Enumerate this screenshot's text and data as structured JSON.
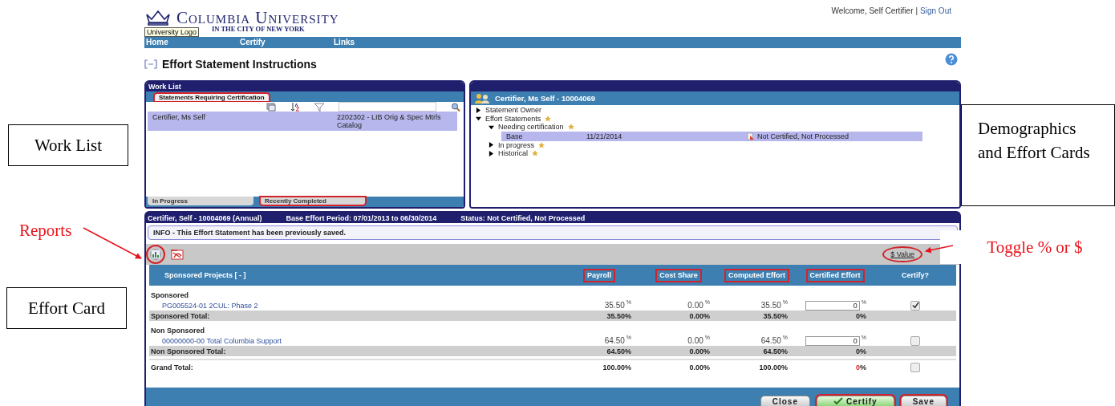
{
  "header": {
    "logo_name": "Columbia University",
    "logo_subtitle": "IN THE CITY OF NEW YORK",
    "tooltip": "University Logo",
    "welcome": "Welcome, Self Certifier",
    "separator": "|",
    "sign_out": "Sign Out"
  },
  "nav": [
    "Home",
    "Certify",
    "Links"
  ],
  "page_title": "Effort Statement Instructions",
  "work_list": {
    "title": "Work List",
    "top_tabs": [
      {
        "label": "Statements Requiring Certification",
        "selected": true,
        "highlighted": true
      }
    ],
    "rows": [
      {
        "name": "Certifier, Ms Self",
        "statement": "2202302 - LIB Orig & Spec Mtrls Catalog",
        "selected": true
      }
    ],
    "bottom_tabs": [
      {
        "label": "In Progress",
        "selected": false,
        "highlighted": false
      },
      {
        "label": "Recently Completed",
        "selected": false,
        "highlighted": true
      }
    ]
  },
  "demographics": {
    "title": "Certifier, Ms Self - 10004069",
    "tree": [
      {
        "label": "Statement Owner",
        "expanded": false,
        "star": false
      },
      {
        "label": "Effort Statements",
        "expanded": true,
        "star": true,
        "children": [
          {
            "label": "Needing certification",
            "expanded": true,
            "star": true,
            "children": [
              {
                "kind": "statement",
                "label": "Base",
                "date": "11/21/2014",
                "status": "Not Certified, Not Processed",
                "selected": true
              }
            ]
          },
          {
            "label": "In progress",
            "expanded": false,
            "star": true
          },
          {
            "label": "Historical",
            "expanded": false,
            "star": true
          }
        ]
      }
    ]
  },
  "effort_card": {
    "owner": "Certifier, Self - 10004069 (Annual)",
    "period": "Base Effort Period: 07/01/2013 to 06/30/2014",
    "status": "Status: Not Certified, Not Processed",
    "info": "INFO - This Effort Statement has been previously saved.",
    "reports_circled": true,
    "toggle_link": {
      "label": "$ Value",
      "circled": true
    },
    "columns": [
      {
        "label": "Sponsored Projects   [ - ]",
        "highlighted": false
      },
      {
        "label": "Payroll",
        "highlighted": true
      },
      {
        "label": "Cost Share",
        "highlighted": true
      },
      {
        "label": "Computed Effort",
        "highlighted": true
      },
      {
        "label": "Certified Effort",
        "highlighted": true
      },
      {
        "label": "Certify?",
        "highlighted": false
      }
    ],
    "sections": [
      {
        "title": "Sponsored",
        "rows": [
          {
            "project": "PG005524-01  2CUL: Phase 2",
            "payroll": {
              "value": "35.50",
              "unit": "%"
            },
            "cost_share": {
              "value": "0.00",
              "unit": "%"
            },
            "computed": {
              "value": "35.50",
              "unit": "%"
            },
            "certified": {
              "value": "0",
              "unit": "%"
            },
            "checked": true
          }
        ],
        "total": {
          "label": "Sponsored Total:",
          "payroll": "35.50%",
          "cost_share": "0.00%",
          "computed": "35.50%",
          "certified": "0%"
        }
      },
      {
        "title": "Non Sponsored",
        "rows": [
          {
            "project": "00000000-00  Total Columbia Support",
            "payroll": {
              "value": "64.50",
              "unit": "%"
            },
            "cost_share": {
              "value": "0.00",
              "unit": "%"
            },
            "computed": {
              "value": "64.50",
              "unit": "%"
            },
            "certified": {
              "value": "0",
              "unit": "%"
            },
            "checked": false
          }
        ],
        "total": {
          "label": "Non Sponsored Total:",
          "payroll": "64.50%",
          "cost_share": "0.00%",
          "computed": "64.50%",
          "certified": "0%"
        }
      }
    ],
    "grand_total": {
      "label": "Grand Total:",
      "payroll": "100.00%",
      "cost_share": "0.00%",
      "computed": "100.00%",
      "certified": {
        "value": "0",
        "unit": "%",
        "flagged": true
      },
      "checked": false
    },
    "buttons": [
      {
        "label": "Close",
        "kind": "plain",
        "highlighted": false
      },
      {
        "label": "Certify",
        "kind": "certify",
        "highlighted": true
      },
      {
        "label": "Save",
        "kind": "plain",
        "highlighted": true
      }
    ]
  },
  "annotations": [
    {
      "label": "Work List",
      "kind": "box"
    },
    {
      "label": "Demographics and Effort Cards",
      "kind": "box"
    },
    {
      "label": "Reports",
      "kind": "arrow"
    },
    {
      "label": "Effort Card",
      "kind": "box"
    },
    {
      "label": "Toggle % or $",
      "kind": "arrow"
    }
  ]
}
